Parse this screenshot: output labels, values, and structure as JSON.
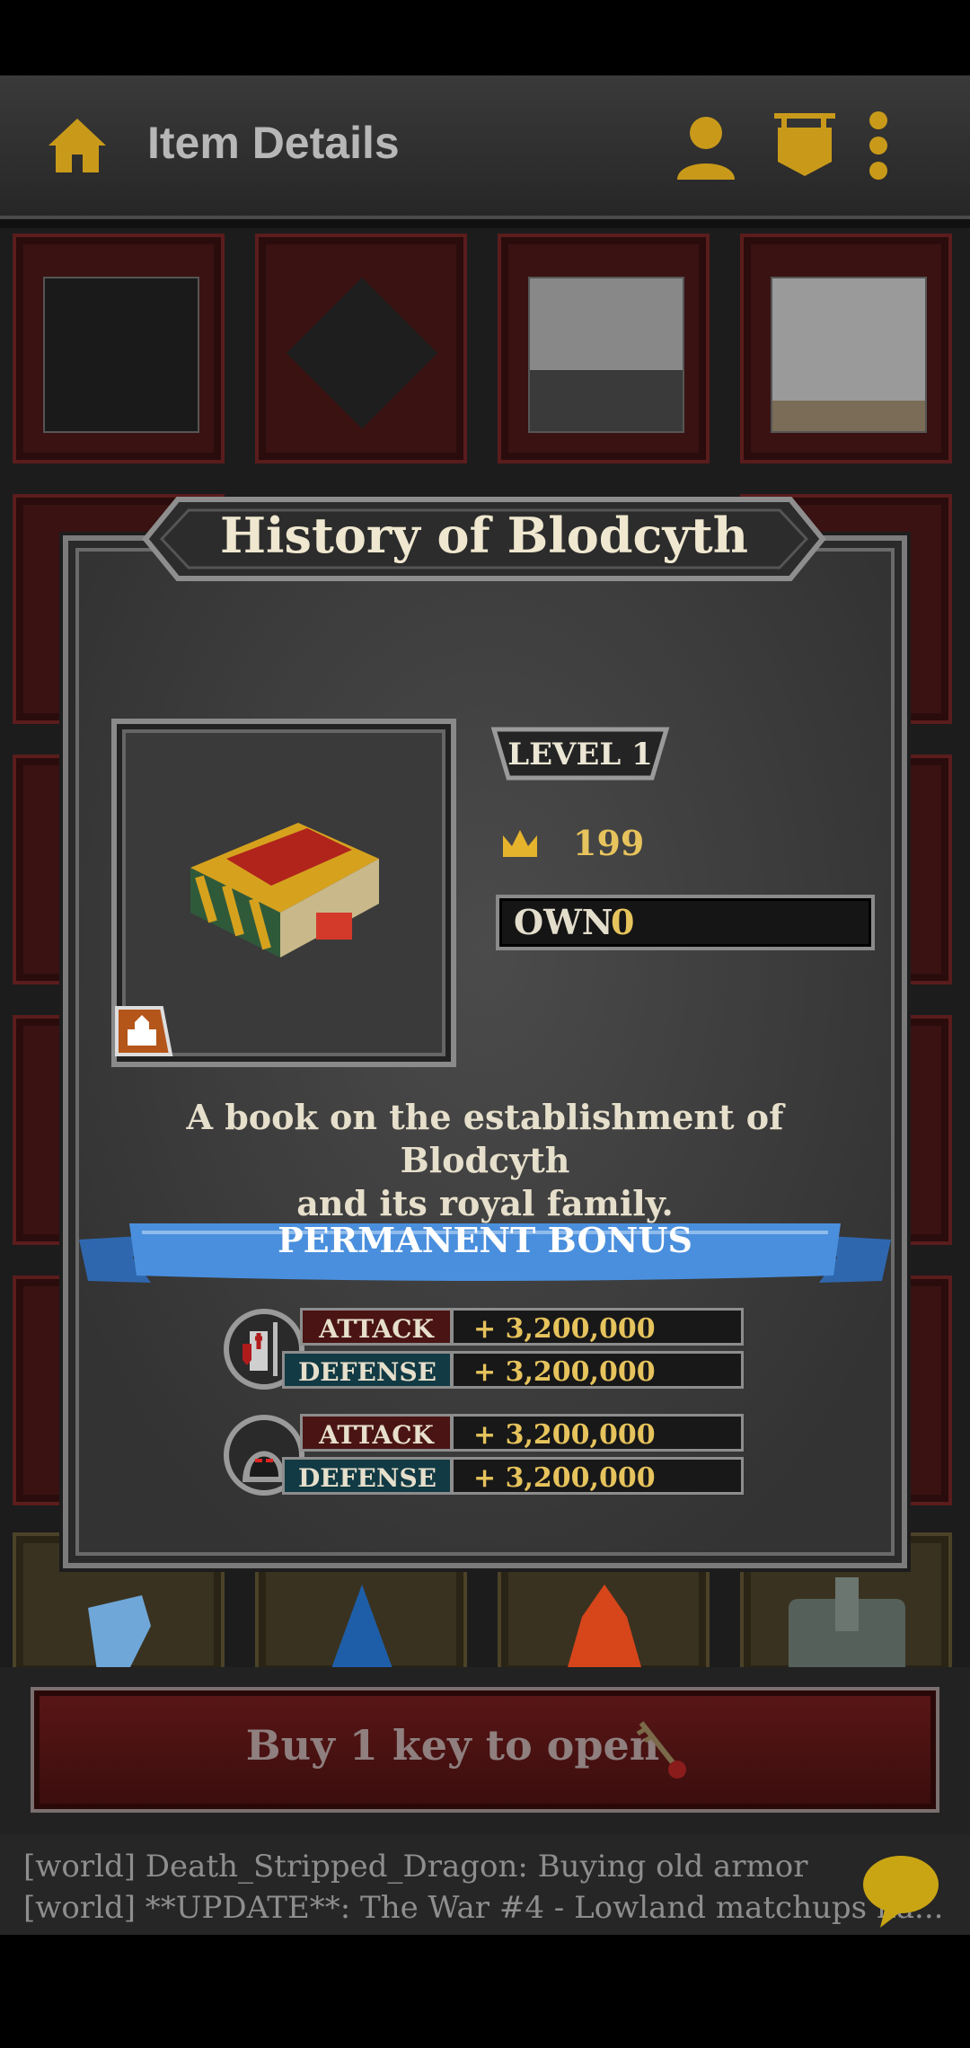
{
  "topbar": {
    "title": "Item Details",
    "icons": [
      "home-icon",
      "profile-icon",
      "guild-banner-icon",
      "more-vertical-icon"
    ]
  },
  "modal": {
    "title": "History of Blodcyth",
    "level": "LEVEL 1",
    "price": "199",
    "own_label": "OWN",
    "own_value": "0",
    "description_line1": "A book on the establishment of Blodcyth",
    "description_line2": "and its royal family.",
    "bonus_header": "PERMANENT BONUS",
    "bonus_groups": [
      {
        "icon": "knight-icon",
        "attack_label": "ATTACK",
        "attack_value": "+ 3,200,000",
        "defense_label": "DEFENSE",
        "defense_value": "+ 3,200,000"
      },
      {
        "icon": "assassin-icon",
        "attack_label": "ATTACK",
        "attack_value": "+ 3,200,000",
        "defense_label": "DEFENSE",
        "defense_value": "+ 3,200,000"
      }
    ]
  },
  "buy": {
    "label": "Buy 1 key to open"
  },
  "chat": {
    "line1": "[world] Death_Stripped_Dragon: Buying old armor",
    "line2": "[world] **UPDATE**: The War #4 - Lowland matchups ha..."
  },
  "colors": {
    "gold": "#e6c35c",
    "ribbon_blue": "#3d7fd1",
    "panel": "#3d3d3d"
  }
}
